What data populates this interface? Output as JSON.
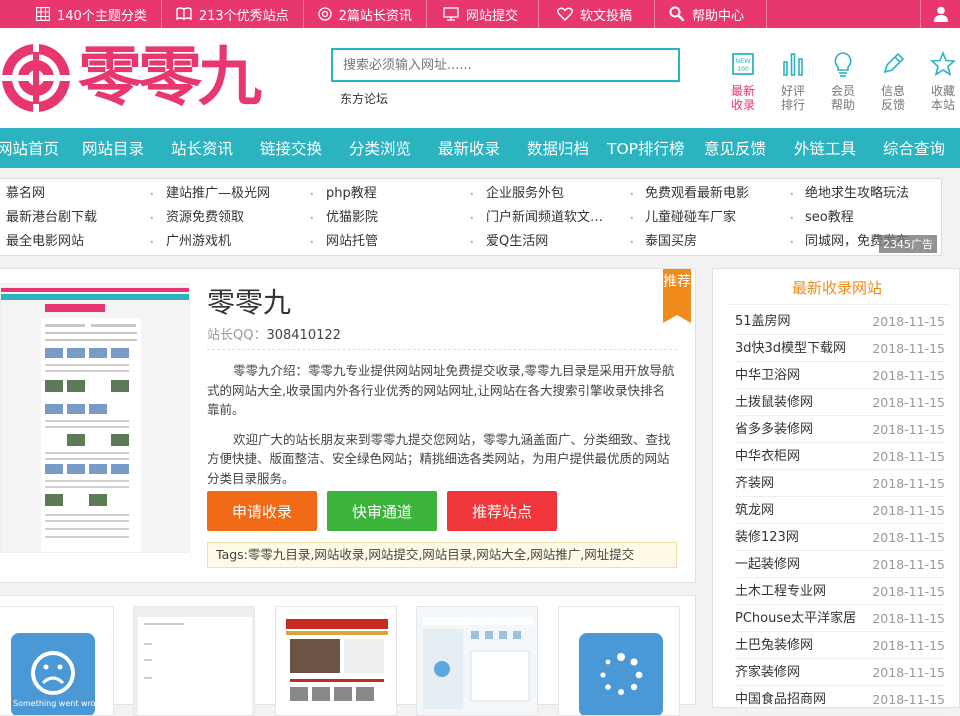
{
  "topbar": {
    "items": [
      "140个主题分类",
      "213个优秀站点",
      "2篇站长资讯",
      "网站提交",
      "软文投稿",
      "帮助中心"
    ]
  },
  "header": {
    "logo_text": "零零九",
    "search_placeholder": "搜索必须输入网址......",
    "hotword": "东方论坛",
    "icons": [
      {
        "label": "最新\n收录",
        "icon": "new-icon"
      },
      {
        "label": "好评\n排行",
        "icon": "bar-chart-icon"
      },
      {
        "label": "会员\n帮助",
        "icon": "lightbulb-icon"
      },
      {
        "label": "信息\n反馈",
        "icon": "pencil-icon"
      },
      {
        "label": "收藏\n本站",
        "icon": "star-icon"
      }
    ],
    "icon_labels_l1": [
      "最新",
      "好评",
      "会员",
      "信息",
      "收藏"
    ],
    "icon_labels_l2": [
      "收录",
      "排行",
      "帮助",
      "反馈",
      "本站"
    ]
  },
  "nav": [
    "网站首页",
    "网站目录",
    "站长资讯",
    "链接交换",
    "分类浏览",
    "最新收录",
    "数据归档",
    "TOP排行榜",
    "意见反馈",
    "外链工具",
    "综合查询"
  ],
  "links": {
    "rows": [
      [
        "慕名网",
        "建站推广—极光网",
        "php教程",
        "企业服务外包",
        "免费观看最新电影",
        "绝地求生攻略玩法"
      ],
      [
        "最新港台剧下载",
        "资源免费领取",
        "优猫影院",
        "门户新闻频道软文…",
        "儿童碰碰车厂家",
        "seo教程"
      ],
      [
        "最全电影网站",
        "广州游戏机",
        "网站托管",
        "爱Q生活网",
        "泰国买房",
        "同城网，免费发布"
      ]
    ],
    "ad_tag": "2345广告"
  },
  "site": {
    "title": "零零九",
    "qq_label": "站长QQ：",
    "qq": "308410122",
    "desc1": "零零九介绍：零零九专业提供网站网址免费提交收录,零零九目录是采用开放导航式的网站大全,收录国内外各行业优秀的网站网址,让网站在各大搜索引擎收录快排名靠前。",
    "desc2": "欢迎广大的站长朋友来到零零九提交您网站，零零九涵盖面广、分类细致、查找方便快捷、版面整洁、安全绿色网站；精挑细选各类网站，为用户提供最优质的网站分类目录服务。",
    "btn_apply": "申请收录",
    "btn_fast": "快审通道",
    "btn_recommend": "推荐站点",
    "tags": "Tags:零零九目录,网站收录,网站提交,网站目录,网站大全,网站推广,网址提交",
    "ribbon": "推荐"
  },
  "colors": {
    "accent": "#e8366f",
    "nav": "#2bb3c0",
    "orange": "#f08a1a",
    "green": "#3cb43c",
    "red": "#f0363a"
  },
  "sidebar": {
    "title": "最新收录网站",
    "items": [
      {
        "name": "51盖房网",
        "date": "2018-11-15"
      },
      {
        "name": "3d快3d模型下载网",
        "date": "2018-11-15"
      },
      {
        "name": "中华卫浴网",
        "date": "2018-11-15"
      },
      {
        "name": "土拨鼠装修网",
        "date": "2018-11-15"
      },
      {
        "name": "省多多装修网",
        "date": "2018-11-15"
      },
      {
        "name": "中华衣柜网",
        "date": "2018-11-15"
      },
      {
        "name": "齐装网",
        "date": "2018-11-15"
      },
      {
        "name": "筑龙网",
        "date": "2018-11-15"
      },
      {
        "name": "装修123网",
        "date": "2018-11-15"
      },
      {
        "name": "一起装修网",
        "date": "2018-11-15"
      },
      {
        "name": "土木工程专业网",
        "date": "2018-11-15"
      },
      {
        "name": "PChouse太平洋家居",
        "date": "2018-11-15"
      },
      {
        "name": "土巴兔装修网",
        "date": "2018-11-15"
      },
      {
        "name": "齐家装修网",
        "date": "2018-11-15"
      },
      {
        "name": "中国食品招商网",
        "date": "2018-11-15"
      }
    ]
  },
  "related": {
    "error_text": "Something went wrong."
  }
}
